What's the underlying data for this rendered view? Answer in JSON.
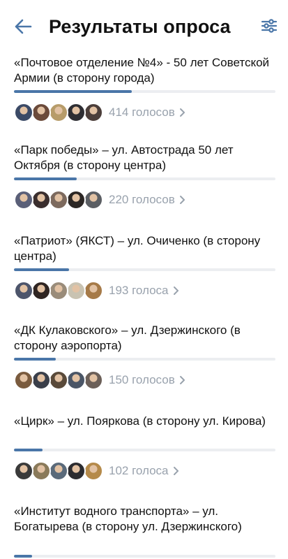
{
  "header": {
    "title": "Результаты опроса",
    "back_icon": "arrow-left-icon",
    "filter_icon": "sliders-icon",
    "accent": "#4a76a8"
  },
  "bar_color": "#4a76a8",
  "options": [
    {
      "text": "«Почтовое отделение №4» - 50 лет Советской Армии (в сторону города)",
      "votes_label": "414 голосов",
      "share": 0.45,
      "avatar_colors": [
        "#3b4a66",
        "#6b4a3a",
        "#b79c6a",
        "#2e2e33",
        "#4b3e3a"
      ]
    },
    {
      "text": "«Парк победы» – ул. Автострада 50 лет Октября (в сторону центра)",
      "votes_label": "220 голосов",
      "share": 0.24,
      "avatar_colors": [
        "#5a5f78",
        "#3a2e2e",
        "#7d6a5e",
        "#2b2624",
        "#5b5e63"
      ]
    },
    {
      "text": "«Патриот» (ЯКСТ) – ул. Очиченко (в сторону центра)",
      "votes_label": "193 голоса",
      "share": 0.21,
      "avatar_colors": [
        "#4d556b",
        "#2f2522",
        "#9a8c7a",
        "#c9c3b2",
        "#a67a48"
      ]
    },
    {
      "text": "«ДК Кулаковского» – ул. Дзержинского (в сторону аэропорта)",
      "votes_label": "150 голосов",
      "share": 0.16,
      "avatar_colors": [
        "#7a5b3e",
        "#3a3f4a",
        "#5a4a3a",
        "#4a5566",
        "#6b5f58"
      ]
    },
    {
      "text": "«Цирк» – ул. Пояркова (в сторону ул. Кирова)",
      "votes_label": "102 голоса",
      "share": 0.11,
      "avatar_colors": [
        "#3a3a3a",
        "#8a7a5a",
        "#5a6a7a",
        "#2c2c30",
        "#b58a4a"
      ]
    },
    {
      "text": "«Институт водного транспорта» – ул. Богатырева (в сторону ул. Дзержинского)",
      "votes_label": "",
      "share": 0.07,
      "avatar_colors": []
    }
  ]
}
